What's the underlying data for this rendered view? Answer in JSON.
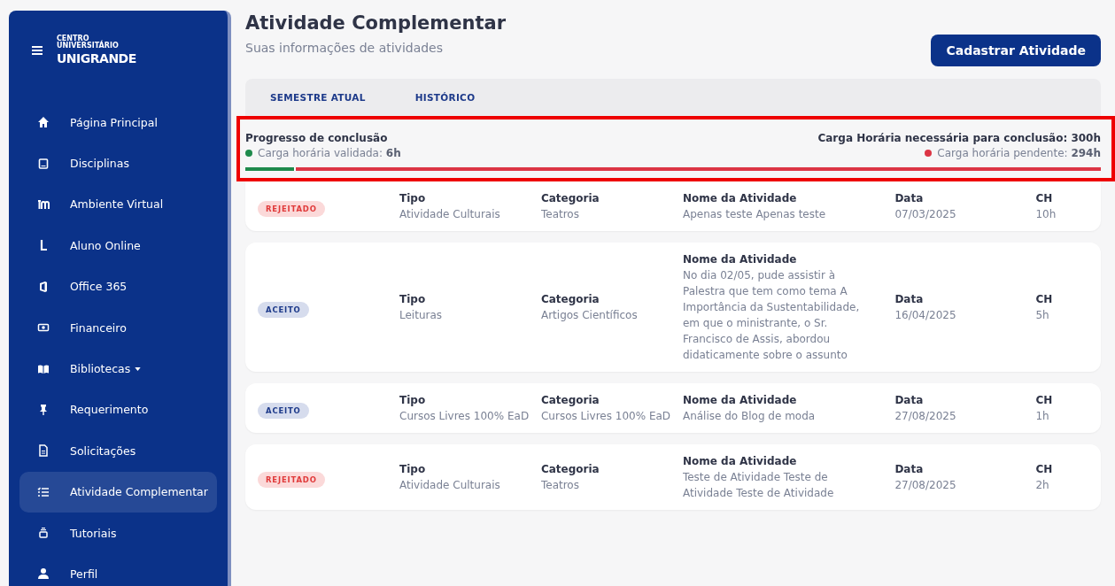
{
  "sidebar": {
    "logo": {
      "line_1": "CENTRO",
      "line_2": "UNIVERSITÁRIO",
      "line_3": "UNIGRANDE"
    },
    "items": [
      {
        "label": "Página Principal",
        "kind": "home",
        "selected": false
      },
      {
        "label": "Disciplinas",
        "kind": "tablet",
        "selected": false
      },
      {
        "label": "Ambiente Virtual",
        "kind": "m",
        "selected": false
      },
      {
        "label": "Aluno Online",
        "kind": "l",
        "selected": false
      },
      {
        "label": "Office 365",
        "kind": "office",
        "selected": false
      },
      {
        "label": "Financeiro",
        "kind": "money",
        "selected": false
      },
      {
        "label": "Bibliotecas",
        "kind": "book",
        "selected": false,
        "dropdown": true
      },
      {
        "label": "Requerimento",
        "kind": "pin",
        "selected": false
      },
      {
        "label": "Solicitações",
        "kind": "file",
        "selected": false
      },
      {
        "label": "Atividade Complementar",
        "kind": "list",
        "selected": true
      },
      {
        "label": "Tutoriais",
        "kind": "tray",
        "selected": false
      },
      {
        "label": "Perfil",
        "kind": "user",
        "selected": false
      }
    ]
  },
  "header": {
    "title": "Atividade Complementar",
    "subtitle": "Suas informações de atividades",
    "button": "Cadastrar Atividade"
  },
  "tabs": [
    "SEMESTRE ATUAL",
    "HISTÓRICO"
  ],
  "progress": {
    "title": "Progresso de conclusão",
    "validated_label": "Carga horária validada: ",
    "validated_value": "6h",
    "required": "Carga Horária necessária para conclusão: 300h",
    "pending_label": "Carga horária pendente: ",
    "pending_value": "294h",
    "level": 0.057
  },
  "activities": [
    {
      "status": "REJEITADO",
      "kind": "rejected",
      "type_label": "Tipo",
      "type": "Atividade Culturais",
      "category_label": "Categoria",
      "category": "Teatros",
      "name_label": "Nome da Atividade",
      "name": "Apenas teste Apenas teste",
      "date_label": "Data",
      "date": "07/03/2025",
      "ch_label": "CH",
      "ch": "10h"
    },
    {
      "status": "ACEITO",
      "kind": "accepted",
      "type_label": "Tipo",
      "type": "Leituras",
      "category_label": "Categoria",
      "category": "Artigos Científicos",
      "name_label": "Nome da Atividade",
      "name": "No dia 02/05, pude assistir à Palestra que tem como tema A Importância da Sustentabilidade, em que o ministrante, o Sr. Francisco de Assis, abordou didaticamente sobre o assunto",
      "date_label": "Data",
      "date": "16/04/2025",
      "ch_label": "CH",
      "ch": "5h"
    },
    {
      "status": "ACEITO",
      "kind": "accepted",
      "type_label": "Tipo",
      "type": "Cursos Livres 100% EaD",
      "category_label": "Categoria",
      "category": "Cursos Livres 100% EaD",
      "name_label": "Nome da Atividade",
      "name": "Análise do Blog de moda",
      "date_label": "Data",
      "date": "27/08/2025",
      "ch_label": "CH",
      "ch": "1h"
    },
    {
      "status": "REJEITADO",
      "kind": "rejected",
      "type_label": "Tipo",
      "type": "Atividade Culturais",
      "category_label": "Categoria",
      "category": "Teatros",
      "name_label": "Nome da Atividade",
      "name": "Teste de Atividade Teste de Atividade Teste de Atividade",
      "date_label": "Data",
      "date": "27/08/2025",
      "ch_label": "CH",
      "ch": "2h"
    }
  ]
}
